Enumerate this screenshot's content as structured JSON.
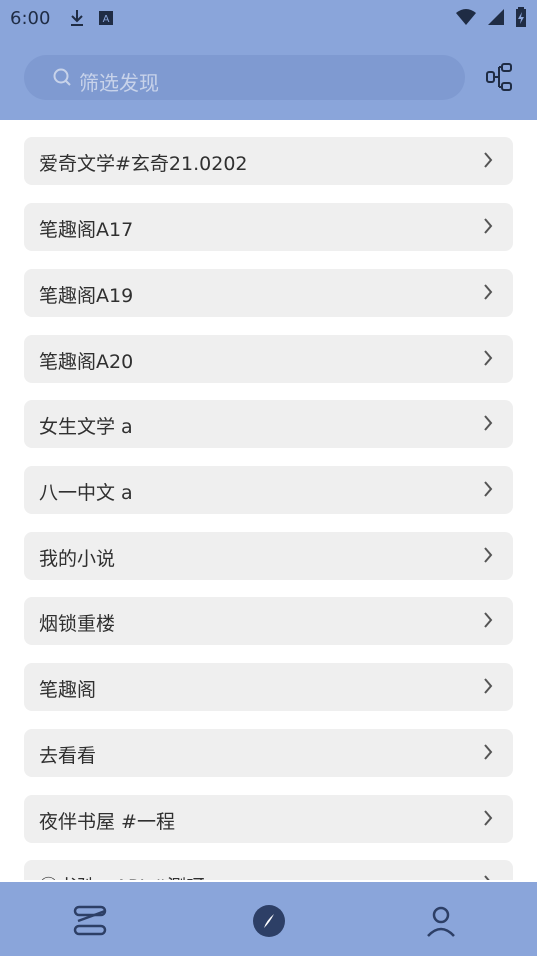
{
  "status_bar": {
    "time": "6:00",
    "icons": [
      "download-icon",
      "font-icon",
      "wifi-icon",
      "signal-icon",
      "battery-icon"
    ]
  },
  "search": {
    "placeholder": "筛选发现"
  },
  "list": [
    "爱奇文学#玄奇21.0202",
    "笔趣阁A17",
    "笔趣阁A19",
    "笔趣阁A20",
    "女生文学 a",
    "八一中文 a",
    "我的小说",
    " 烟锁重楼",
    " 笔趣阁",
    " 去看看",
    " 夜伴书屋 #一程",
    "㊣书驰 - API #测呀"
  ],
  "bottom_nav": [
    "bookshelf-icon",
    "explore-icon",
    "profile-icon"
  ],
  "colors": {
    "header": "#8aa5da",
    "search": "#7f9ad1",
    "row": "#efefef",
    "text": "#303030"
  }
}
